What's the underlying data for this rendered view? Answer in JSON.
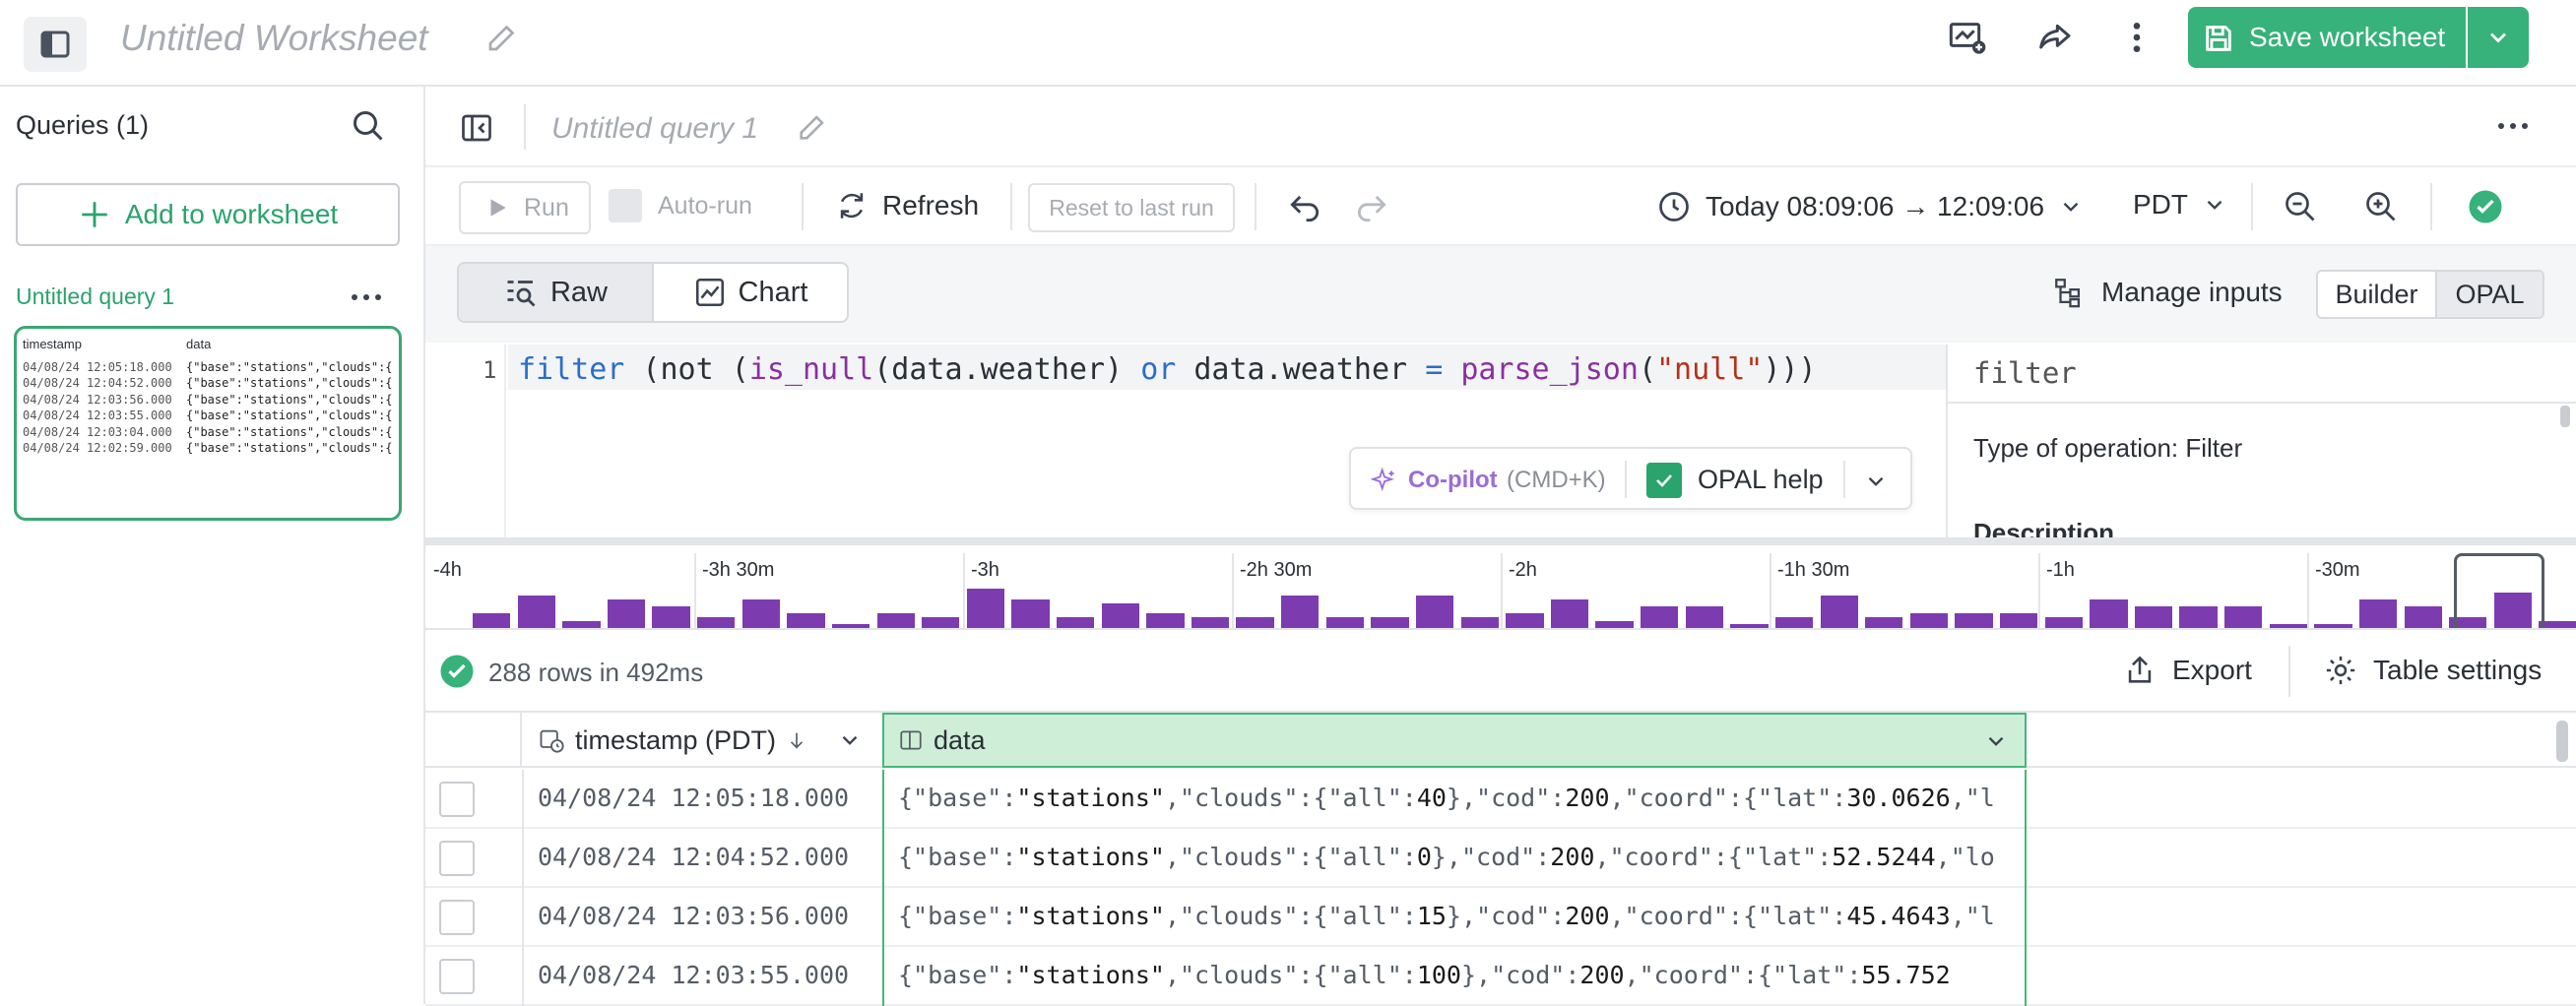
{
  "header": {
    "worksheet_title": "Untitled Worksheet",
    "save_label": "Save worksheet",
    "accent_color": "#36b27a"
  },
  "sidebar": {
    "title": "Queries (1)",
    "add_label": "Add to worksheet",
    "query_name": "Untitled query 1",
    "thumb": {
      "col_ts": "timestamp",
      "col_data": "data",
      "rows": [
        {
          "ts": "04/08/24 12:05:18.000",
          "d": "{\"base\":\"stations\",\"clouds\":{"
        },
        {
          "ts": "04/08/24 12:04:52.000",
          "d": "{\"base\":\"stations\",\"clouds\":{"
        },
        {
          "ts": "04/08/24 12:03:56.000",
          "d": "{\"base\":\"stations\",\"clouds\":{"
        },
        {
          "ts": "04/08/24 12:03:55.000",
          "d": "{\"base\":\"stations\",\"clouds\":{"
        },
        {
          "ts": "04/08/24 12:03:04.000",
          "d": "{\"base\":\"stations\",\"clouds\":{"
        },
        {
          "ts": "04/08/24 12:02:59.000",
          "d": "{\"base\":\"stations\",\"clouds\":{"
        }
      ]
    }
  },
  "query": {
    "title": "Untitled query 1"
  },
  "toolbar": {
    "run": "Run",
    "autorun": "Auto-run",
    "refresh": "Refresh",
    "reset": "Reset to last run",
    "time_range": "Today 08:09:06 → 12:09:06",
    "timezone": "PDT"
  },
  "modes": {
    "raw": "Raw",
    "chart": "Chart",
    "manage_inputs": "Manage inputs",
    "builder": "Builder",
    "opal": "OPAL"
  },
  "editor": {
    "line_number": "1",
    "tokens": [
      {
        "t": "filter",
        "c": "k-kw"
      },
      {
        "t": " (not (",
        "c": "k-plain"
      },
      {
        "t": "is_null",
        "c": "k-fn"
      },
      {
        "t": "(data.weather) ",
        "c": "k-plain"
      },
      {
        "t": "or",
        "c": "k-kw"
      },
      {
        "t": " data.weather ",
        "c": "k-plain"
      },
      {
        "t": "=",
        "c": "k-kw"
      },
      {
        "t": " ",
        "c": "k-plain"
      },
      {
        "t": "parse_json",
        "c": "k-fn"
      },
      {
        "t": "(",
        "c": "k-plain"
      },
      {
        "t": "\"null\"",
        "c": "k-str"
      },
      {
        "t": ")))",
        "c": "k-plain"
      }
    ],
    "copilot_label": "Co-pilot",
    "copilot_shortcut": "(CMD+K)",
    "opal_help": "OPAL help"
  },
  "help": {
    "keyword": "filter",
    "type": "Type of operation: Filter",
    "description_heading": "Description"
  },
  "histogram": {
    "labels": [
      "-4h",
      "-3h 30m",
      "-3h",
      "-2h 30m",
      "-2h",
      "-1h 30m",
      "-1h",
      "-30m"
    ],
    "values": [
      4,
      9,
      2,
      8,
      6,
      3,
      8,
      4,
      1,
      4,
      3,
      11,
      8,
      3,
      7,
      4,
      3,
      3,
      9,
      3,
      3,
      9,
      3,
      4,
      8,
      2,
      6,
      6,
      1,
      3,
      9,
      3,
      4,
      4,
      4,
      3,
      8,
      6,
      6,
      6,
      1,
      1,
      8,
      6,
      3,
      10,
      2
    ],
    "color": "#7d3bb0"
  },
  "results": {
    "summary": "288 rows in 492ms",
    "export": "Export",
    "table_settings": "Table settings",
    "columns": {
      "timestamp": "timestamp (PDT)",
      "data": "data"
    },
    "rows": [
      {
        "ts": "04/08/24 12:05:18.000",
        "parts": [
          [
            "{\"base\":",
            0
          ],
          [
            "\"stations\"",
            1
          ],
          [
            ",\"clouds\":{\"all\":",
            0
          ],
          [
            "40",
            1
          ],
          [
            "},\"cod\":",
            0
          ],
          [
            "200",
            1
          ],
          [
            ",\"coord\":{\"lat\":",
            0
          ],
          [
            "30.0626",
            1
          ],
          [
            ",\"l",
            0
          ]
        ]
      },
      {
        "ts": "04/08/24 12:04:52.000",
        "parts": [
          [
            "{\"base\":",
            0
          ],
          [
            "\"stations\"",
            1
          ],
          [
            ",\"clouds\":{\"all\":",
            0
          ],
          [
            "0",
            1
          ],
          [
            "},\"cod\":",
            0
          ],
          [
            "200",
            1
          ],
          [
            ",\"coord\":{\"lat\":",
            0
          ],
          [
            "52.5244",
            1
          ],
          [
            ",\"lo",
            0
          ]
        ]
      },
      {
        "ts": "04/08/24 12:03:56.000",
        "parts": [
          [
            "{\"base\":",
            0
          ],
          [
            "\"stations\"",
            1
          ],
          [
            ",\"clouds\":{\"all\":",
            0
          ],
          [
            "15",
            1
          ],
          [
            "},\"cod\":",
            0
          ],
          [
            "200",
            1
          ],
          [
            ",\"coord\":{\"lat\":",
            0
          ],
          [
            "45.4643",
            1
          ],
          [
            ",\"l",
            0
          ]
        ]
      },
      {
        "ts": "04/08/24 12:03:55.000",
        "parts": [
          [
            "{\"base\":",
            0
          ],
          [
            "\"stations\"",
            1
          ],
          [
            ",\"clouds\":{\"all\":",
            0
          ],
          [
            "100",
            1
          ],
          [
            "},\"cod\":",
            0
          ],
          [
            "200",
            1
          ],
          [
            ",\"coord\":{\"lat\":",
            0
          ],
          [
            "55.752",
            1
          ]
        ]
      }
    ]
  }
}
